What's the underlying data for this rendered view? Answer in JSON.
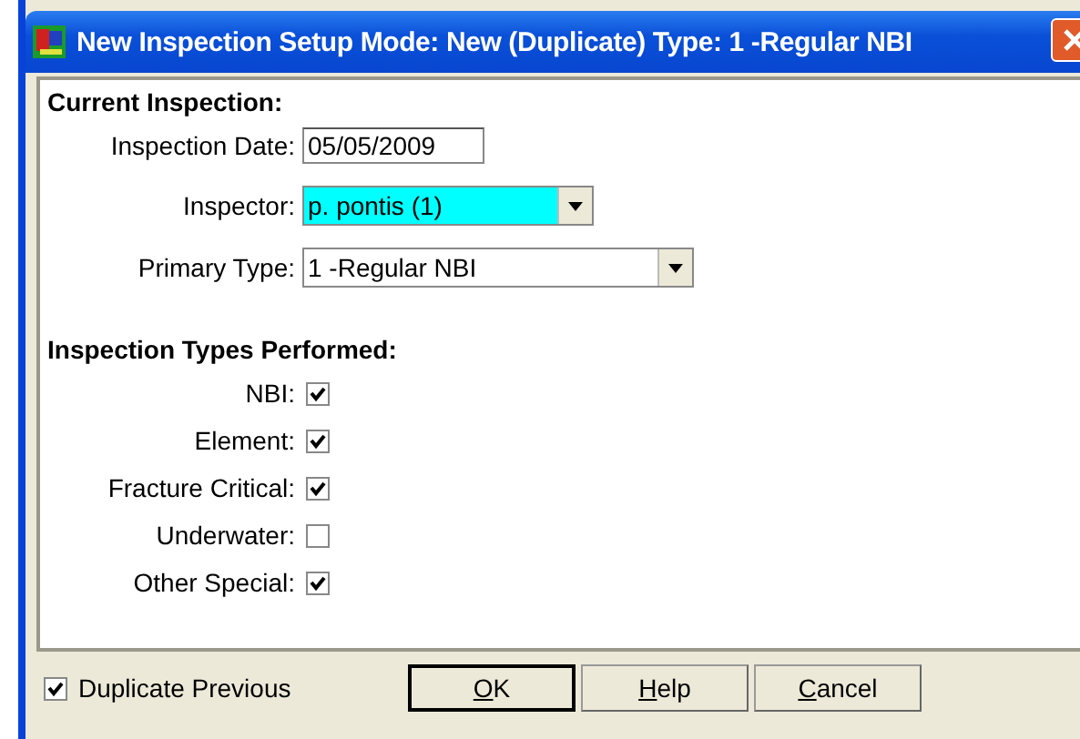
{
  "window": {
    "title": "New Inspection Setup Mode: New (Duplicate) Type: 1 -Regular NBI"
  },
  "current_inspection": {
    "heading": "Current Inspection:",
    "fields": [
      {
        "kind": "text",
        "label": "Inspection Date:",
        "value": "05/05/2009"
      },
      {
        "kind": "dropdown",
        "label": "Inspector:",
        "value": "p. pontis (1)",
        "highlighted": true
      },
      {
        "kind": "dropdown",
        "label": "Primary Type:",
        "value": "1 -Regular NBI",
        "highlighted": false
      }
    ]
  },
  "inspection_types": {
    "heading": "Inspection Types Performed:",
    "items": [
      {
        "label": "NBI:",
        "checked": true
      },
      {
        "label": "Element:",
        "checked": true
      },
      {
        "label": "Fracture Critical:",
        "checked": true
      },
      {
        "label": "Underwater:",
        "checked": false
      },
      {
        "label": "Other Special:",
        "checked": true
      }
    ]
  },
  "duplicate_previous": {
    "label": "Duplicate Previous",
    "checked": true
  },
  "buttons": [
    {
      "label": "OK",
      "default": true
    },
    {
      "label": "Help",
      "default": false
    },
    {
      "label": "Cancel",
      "default": false
    }
  ]
}
